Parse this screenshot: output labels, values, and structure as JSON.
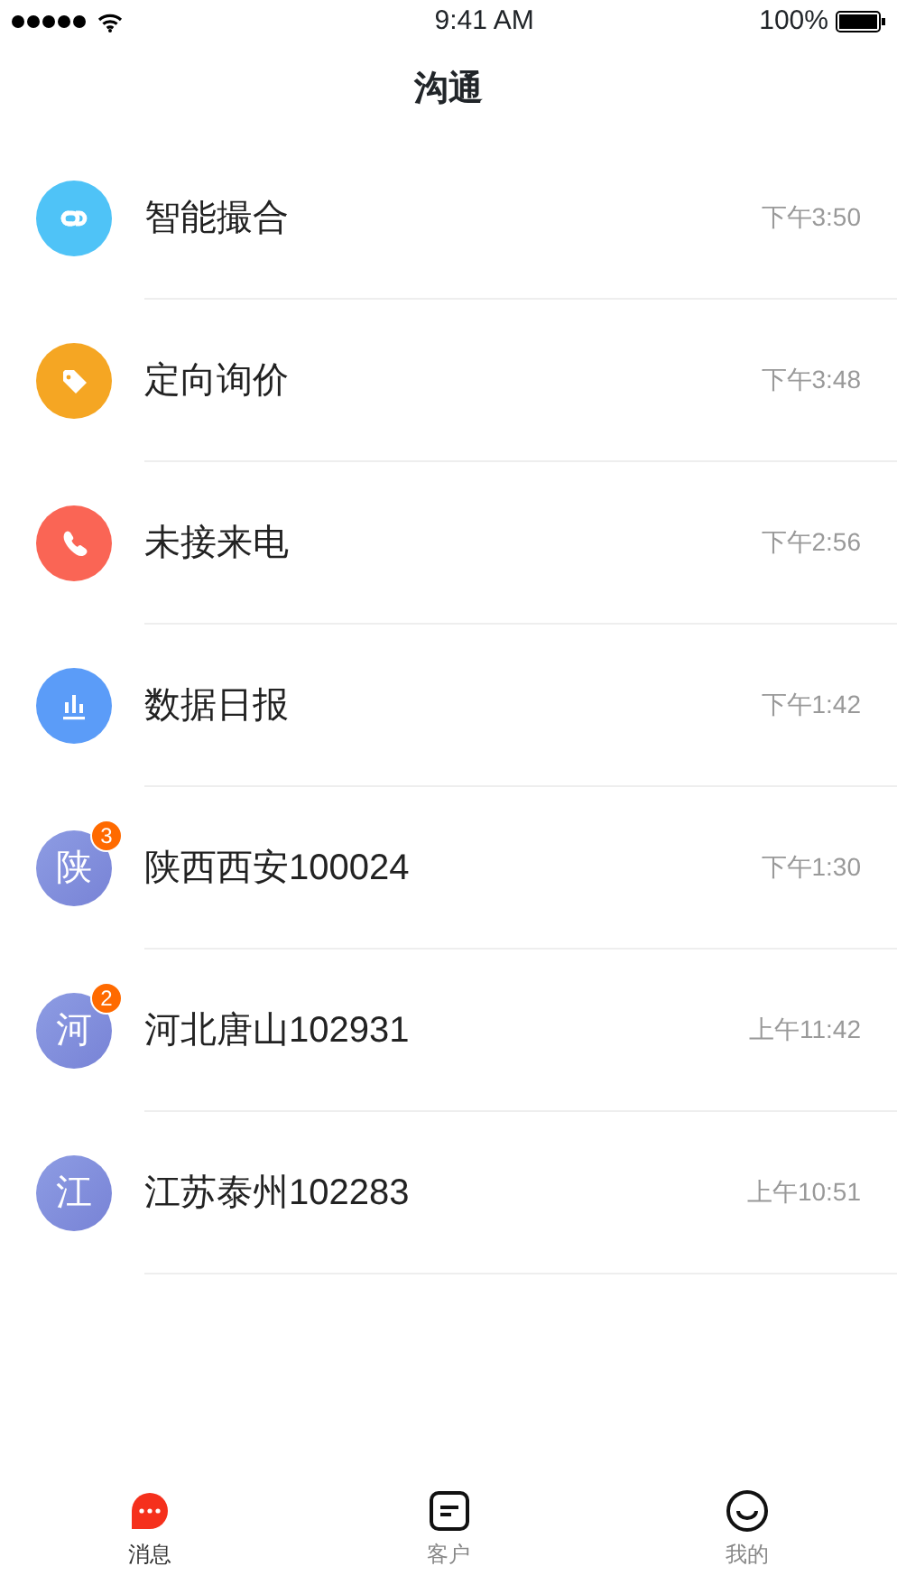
{
  "status_bar": {
    "time": "9:41 AM",
    "battery": "100%"
  },
  "title": "沟通",
  "conversations": [
    {
      "kind": "link",
      "color": "#4fc3f7",
      "name": "智能撮合",
      "time": "下午3:50"
    },
    {
      "kind": "tag",
      "color": "#f5a623",
      "name": "定向询价",
      "time": "下午3:48"
    },
    {
      "kind": "phone",
      "color": "#fa6555",
      "name": "未接来电",
      "time": "下午2:56"
    },
    {
      "kind": "chart",
      "color": "#5b9cf8",
      "name": "数据日报",
      "time": "下午1:42"
    },
    {
      "kind": "contact",
      "avatar": "陕",
      "badge": "3",
      "name": "陕西西安100024",
      "time": "下午1:30"
    },
    {
      "kind": "contact",
      "avatar": "河",
      "badge": "2",
      "name": "河北唐山102931",
      "time": "上午11:42"
    },
    {
      "kind": "contact",
      "avatar": "江",
      "name": "江苏泰州102283",
      "time": "上午10:51"
    }
  ],
  "tabs": [
    {
      "kind": "chat",
      "label": "消息",
      "selected": true
    },
    {
      "kind": "note",
      "label": "客户",
      "selected": false
    },
    {
      "kind": "smile",
      "label": "我的",
      "selected": false
    }
  ]
}
